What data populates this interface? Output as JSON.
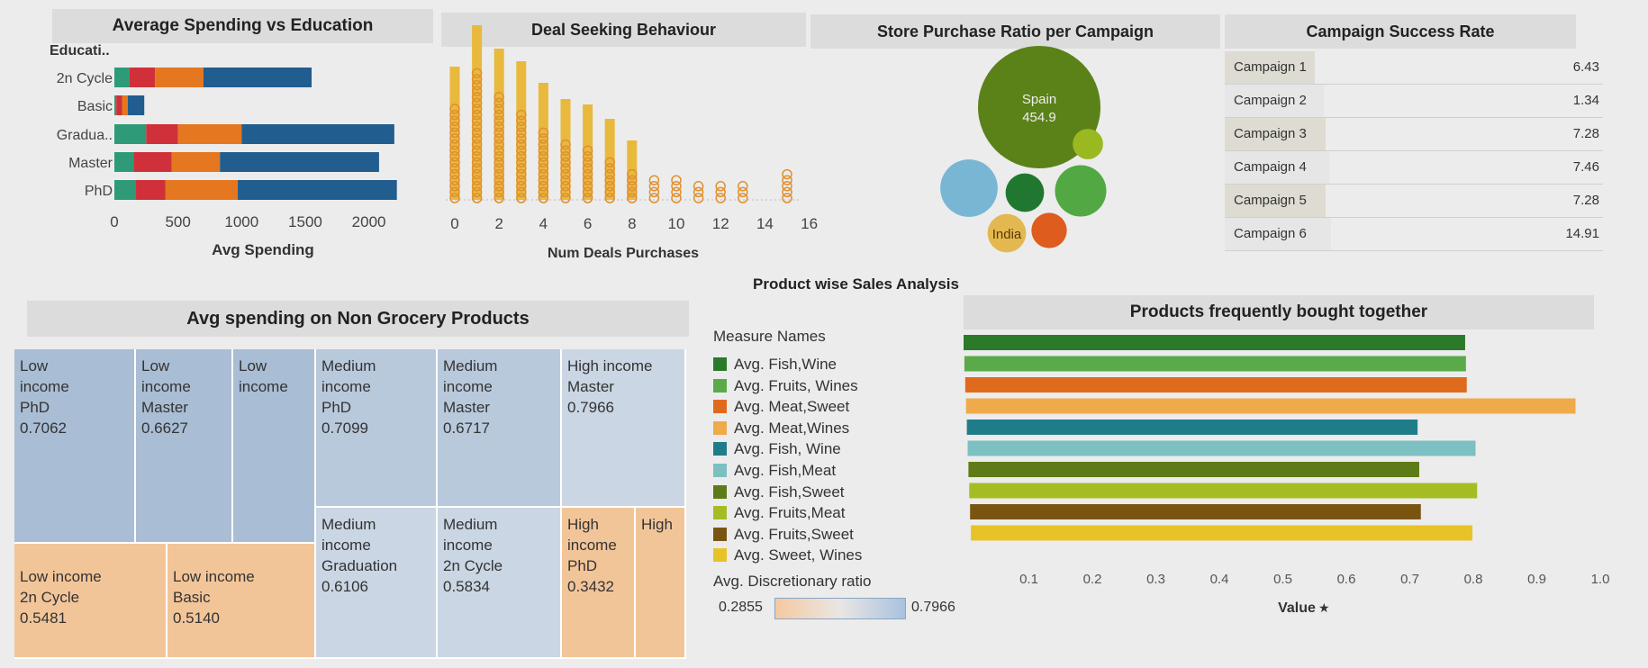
{
  "titles": {
    "edu": "Average Spending vs Education",
    "deal": "Deal Seeking Behaviour",
    "store": "Store Purchase Ratio per Campaign",
    "campaign": "Campaign Success Rate",
    "nongrocery": "Avg spending on Non Grocery Products",
    "product": "Product wise Sales Analysis",
    "together": "Products frequently bought together"
  },
  "colors": {
    "s1": "#2e9a78",
    "s2": "#d0303a",
    "s3": "#e4771f",
    "s4": "#215d8f",
    "deal": "#e8b93c",
    "dealStroke": "#e09030",
    "tm_blue": "#a9bdd4",
    "tm_blue2": "#b9c9dc",
    "tm_peach": "#f2c599",
    "tm_light": "#cad6e3"
  },
  "chart_data": [
    {
      "type": "bar",
      "title": "Average Spending vs Education",
      "ylabel": "Educati..",
      "xlabel": "Avg Spending",
      "categories": [
        "2n Cycle",
        "Basic",
        "Gradua..",
        "Master",
        "PhD"
      ],
      "xticks": [
        "0",
        "500",
        "1000",
        "1500",
        "2000"
      ],
      "xlim": [
        0,
        2150
      ],
      "stacked": true,
      "series": [
        {
          "values": [
            120,
            15,
            250,
            150,
            170
          ]
        },
        {
          "values": [
            200,
            45,
            250,
            300,
            230
          ]
        },
        {
          "values": [
            380,
            45,
            500,
            380,
            570
          ]
        },
        {
          "values": [
            850,
            130,
            1200,
            1250,
            1250
          ]
        }
      ]
    },
    {
      "type": "scatter",
      "title": "Deal Seeking Behaviour",
      "xlabel": "Num Deals Purchases",
      "xticks": [
        "0",
        "2",
        "4",
        "6",
        "8",
        "10",
        "12",
        "14",
        "16"
      ],
      "xlim": [
        0,
        16
      ],
      "columns": [
        {
          "x": 0,
          "n": 16,
          "bar": 7.3
        },
        {
          "x": 1,
          "n": 22,
          "bar": 9.6
        },
        {
          "x": 2,
          "n": 18,
          "bar": 8.3
        },
        {
          "x": 3,
          "n": 15,
          "bar": 7.6
        },
        {
          "x": 4,
          "n": 12,
          "bar": 6.4
        },
        {
          "x": 5,
          "n": 10,
          "bar": 5.5
        },
        {
          "x": 6,
          "n": 9,
          "bar": 5.2
        },
        {
          "x": 7,
          "n": 7,
          "bar": 4.4
        },
        {
          "x": 8,
          "n": 5,
          "bar": 3.2
        },
        {
          "x": 9,
          "n": 4,
          "bar": 0
        },
        {
          "x": 10,
          "n": 4,
          "bar": 0
        },
        {
          "x": 11,
          "n": 3,
          "bar": 0
        },
        {
          "x": 12,
          "n": 3,
          "bar": 0
        },
        {
          "x": 13,
          "n": 3,
          "bar": 0
        },
        {
          "x": 15,
          "n": 5,
          "bar": 0
        }
      ]
    },
    {
      "type": "bubble",
      "title": "Store Purchase Ratio per Campaign",
      "bubbles": [
        {
          "label": "Spain",
          "value": "454.9",
          "size": 454.9,
          "color": "#5b8218"
        },
        {
          "label": "",
          "value": "",
          "size": 100,
          "color": "#78b6d3"
        },
        {
          "label": "",
          "value": "",
          "size": 45,
          "color": "#207830"
        },
        {
          "label": "",
          "value": "",
          "size": 80,
          "color": "#52a843"
        },
        {
          "label": "",
          "value": "",
          "size": 28,
          "color": "#9ab81f"
        },
        {
          "label": "India",
          "value": "",
          "size": 45,
          "color": "#e4b850"
        },
        {
          "label": "",
          "value": "",
          "size": 38,
          "color": "#de5c1d"
        }
      ]
    },
    {
      "type": "table",
      "title": "Campaign Success Rate",
      "rows": [
        {
          "name": "Campaign 1",
          "value": "6.43"
        },
        {
          "name": "Campaign 2",
          "value": "1.34"
        },
        {
          "name": "Campaign 3",
          "value": "7.28"
        },
        {
          "name": "Campaign 4",
          "value": "7.46"
        },
        {
          "name": "Campaign 5",
          "value": "7.28"
        },
        {
          "name": "Campaign 6",
          "value": "14.91"
        }
      ]
    },
    {
      "type": "treemap",
      "title": "Avg spending on Non Grocery Products",
      "cells": [
        {
          "lines": [
            "Low",
            "income",
            "PhD",
            "0.7062"
          ]
        },
        {
          "lines": [
            "Low",
            "income",
            "Master",
            "0.6627"
          ]
        },
        {
          "lines": [
            "Low",
            "income"
          ]
        },
        {
          "lines": [
            "Medium",
            "income",
            "PhD",
            "0.7099"
          ]
        },
        {
          "lines": [
            "Medium",
            "income",
            "Master",
            "0.6717"
          ]
        },
        {
          "lines": [
            "High income",
            "Master",
            "0.7966"
          ]
        },
        {
          "lines": [
            "Low income",
            "2n Cycle",
            "0.5481"
          ]
        },
        {
          "lines": [
            "Low income",
            "Basic",
            "0.5140"
          ]
        },
        {
          "lines": [
            "Medium",
            "income",
            "Graduation",
            "0.6106"
          ]
        },
        {
          "lines": [
            "Medium",
            "income",
            "2n Cycle",
            "0.5834"
          ]
        },
        {
          "lines": [
            "High",
            "income",
            "PhD",
            "0.3432"
          ]
        },
        {
          "lines": [
            "High"
          ]
        }
      ],
      "legend_title": "Avg. Discretionary ratio",
      "legend_min": "0.2855",
      "legend_max": "0.7966"
    },
    {
      "type": "bar",
      "title": "Products frequently bought together",
      "legend_title": "Measure Names",
      "xlabel": "Value",
      "xticks": [
        "0.1",
        "0.2",
        "0.3",
        "0.4",
        "0.5",
        "0.6",
        "0.7",
        "0.8",
        "0.9",
        "1.0"
      ],
      "xlim": [
        0.0,
        1.0
      ],
      "series": [
        {
          "name": "Avg. Fish,Wine",
          "value": 0.79,
          "color": "#2b7a2a"
        },
        {
          "name": "Avg. Fruits, Wines",
          "value": 0.79,
          "color": "#5aaa4a"
        },
        {
          "name": "Avg. Meat,Sweet",
          "value": 0.79,
          "color": "#e06a1c"
        },
        {
          "name": "Avg. Meat,Wines",
          "value": 0.96,
          "color": "#efaa4a"
        },
        {
          "name": "Avg. Fish, Wine",
          "value": 0.71,
          "color": "#1f7d8a"
        },
        {
          "name": "Avg. Fish,Meat",
          "value": 0.8,
          "color": "#7cc0c2"
        },
        {
          "name": "Avg. Fish,Sweet",
          "value": 0.71,
          "color": "#5d7b16"
        },
        {
          "name": "Avg. Fruits,Meat",
          "value": 0.8,
          "color": "#a5bd22"
        },
        {
          "name": "Avg. Fruits,Sweet",
          "value": 0.71,
          "color": "#7a5512"
        },
        {
          "name": "Avg. Sweet, Wines",
          "value": 0.79,
          "color": "#e8c328"
        }
      ]
    }
  ]
}
